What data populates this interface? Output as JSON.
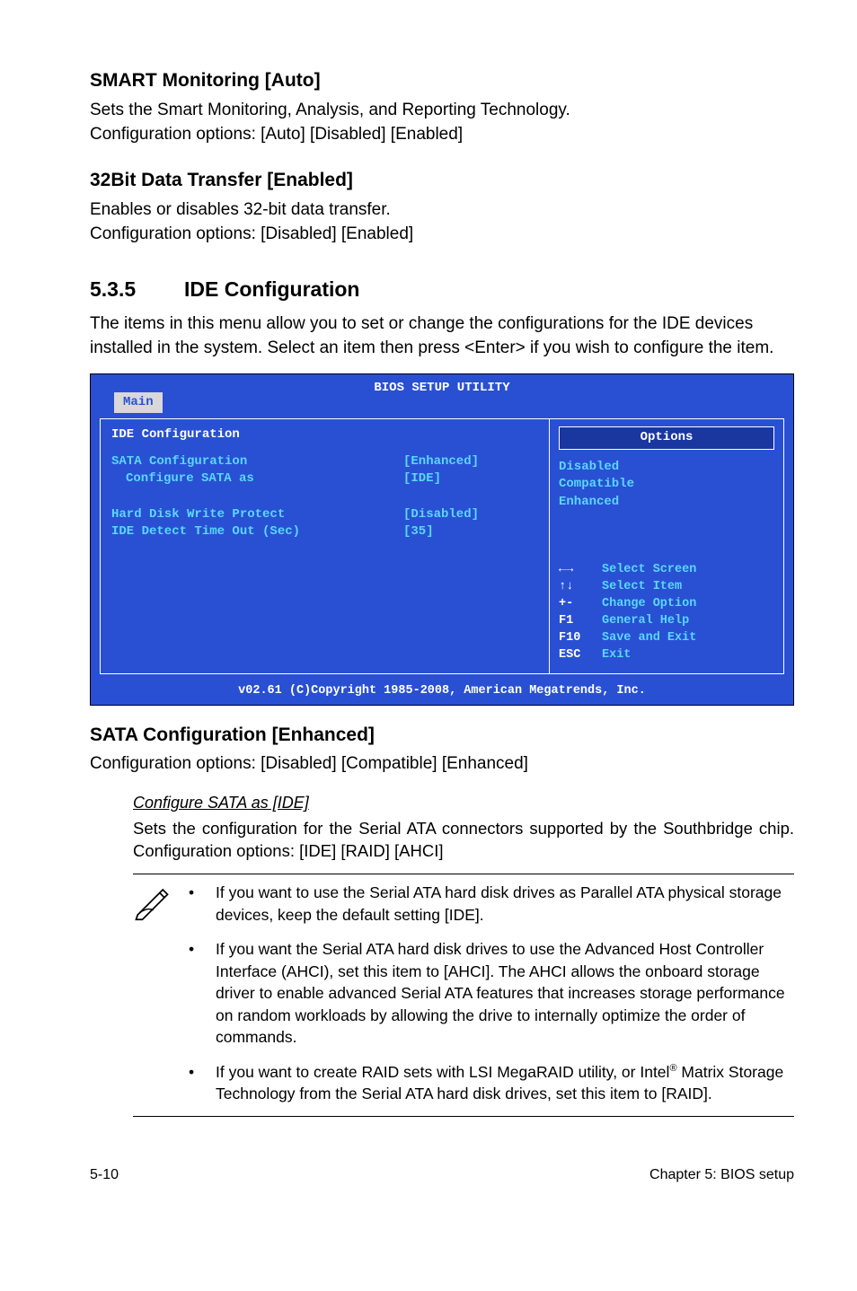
{
  "doc": {
    "h1_title": "SMART Monitoring [Auto]",
    "h1_desc1": "Sets the Smart Monitoring, Analysis, and Reporting Technology.",
    "h1_desc2": "Configuration options: [Auto] [Disabled] [Enabled]",
    "h2_title": "32Bit Data Transfer [Enabled]",
    "h2_desc1": "Enables or disables 32-bit data transfer.",
    "h2_desc2": "Configuration options: [Disabled] [Enabled]",
    "section_num": "5.3.5",
    "section_title": "IDE Configuration",
    "intro": "The items in this menu allow you to set or change the configurations for the IDE devices installed in the system. Select an item then press <Enter> if you wish to configure the item.",
    "h3_title": "SATA Configuration [Enhanced]",
    "h3_desc": "Configuration options: [Disabled] [Compatible] [Enhanced]",
    "sub_link": "Configure SATA as [IDE]",
    "sub_desc": "Sets the configuration for the Serial ATA connectors supported by the Southbridge chip. Configuration options: [IDE] [RAID] [AHCI]",
    "bullet1": "If you want to use the Serial ATA hard disk drives as Parallel ATA physical storage devices, keep the default setting [IDE].",
    "bullet2": "If you want the Serial ATA hard disk drives to use the Advanced Host Controller Interface (AHCI), set this item to [AHCI]. The AHCI allows the onboard storage driver to enable advanced Serial ATA features that increases storage performance on random workloads by allowing the drive to internally optimize the order of commands.",
    "bullet3a": "If you want to create RAID sets with LSI MegaRAID utility, or Intel",
    "bullet3b": " Matrix Storage Technology from the Serial ATA hard disk drives, set this item to [RAID].",
    "footer_left": "5-10",
    "footer_right": "Chapter 5: BIOS setup"
  },
  "bios": {
    "title": "BIOS SETUP UTILITY",
    "tab": "Main",
    "left_title": "IDE Configuration",
    "rows": [
      {
        "label": "SATA Configuration",
        "val": "[Enhanced]",
        "indent": false
      },
      {
        "label": "Configure SATA as",
        "val": "[IDE]",
        "indent": true
      },
      {
        "label": "",
        "val": "",
        "indent": false
      },
      {
        "label": "Hard Disk Write Protect",
        "val": "[Disabled]",
        "indent": false
      },
      {
        "label": "IDE Detect Time Out (Sec)",
        "val": "[35]",
        "indent": false
      }
    ],
    "opt_title": "Options",
    "opts": [
      "Disabled",
      "Compatible",
      "Enhanced"
    ],
    "hints": [
      {
        "k": "←→",
        "t": "Select Screen"
      },
      {
        "k": "↑↓",
        "t": "Select Item"
      },
      {
        "k": "+-",
        "t": "Change Option"
      },
      {
        "k": "F1",
        "t": "General Help"
      },
      {
        "k": "F10",
        "t": "Save and Exit"
      },
      {
        "k": "ESC",
        "t": "Exit"
      }
    ],
    "footer": "v02.61 (C)Copyright 1985-2008, American Megatrends, Inc."
  }
}
